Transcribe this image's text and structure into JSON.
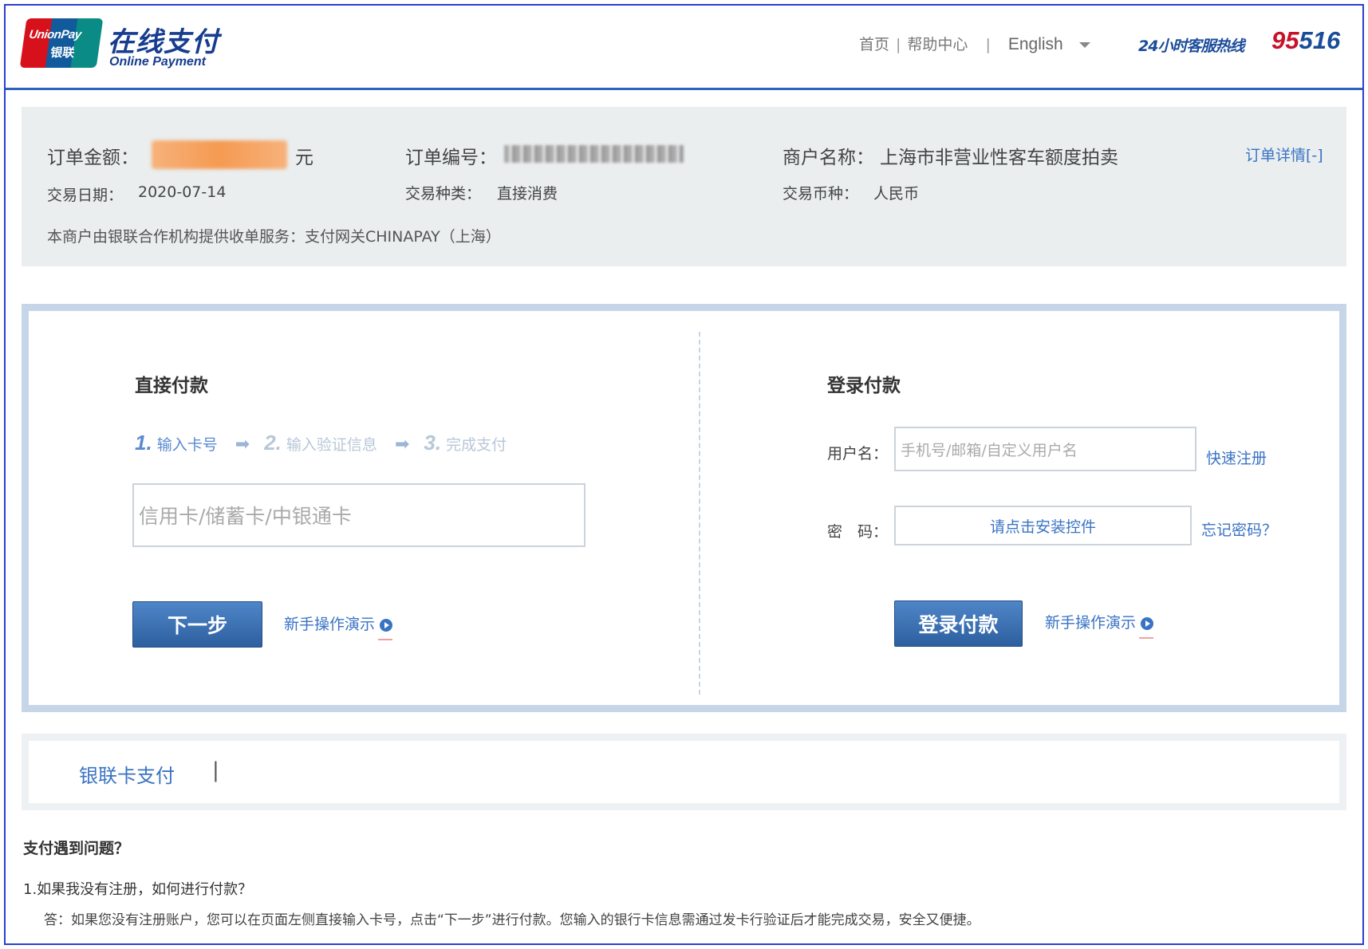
{
  "header": {
    "logo_top": "UnionPay",
    "logo_bottom": "银联",
    "brand_cn": "在线支付",
    "brand_en": "Online Payment",
    "nav_home": "首页",
    "nav_sep": "|",
    "nav_help": "帮助中心",
    "nav_language": "English",
    "hotline_label": "24小时客服热线",
    "hotline_number_red": "95",
    "hotline_number_blue": "516"
  },
  "order": {
    "amount_label": "订单金额：",
    "amount_unit": "元",
    "order_no_label": "订单编号：",
    "merchant_label": "商户名称：",
    "merchant_name": "上海市非营业性客车额度拍卖",
    "detail_link": "订单详情[-]",
    "date_label": "交易日期：",
    "date_value": "2020-07-14",
    "type_label": "交易种类：",
    "type_value": "直接消费",
    "currency_label": "交易币种：",
    "currency_value": "人民币",
    "service_note": "本商户由银联合作机构提供收单服务：支付网关CHINAPAY（上海）"
  },
  "direct_pay": {
    "title": "直接付款",
    "steps": [
      {
        "num": "1.",
        "label": "输入卡号"
      },
      {
        "num": "2.",
        "label": "输入验证信息"
      },
      {
        "num": "3.",
        "label": "完成支付"
      }
    ],
    "arrow": "➡",
    "card_placeholder": "信用卡/储蓄卡/中银通卡",
    "next_button": "下一步",
    "demo_link": "新手操作演示"
  },
  "login_pay": {
    "title": "登录付款",
    "username_label": "用户名：",
    "username_placeholder": "手机号/邮箱/自定义用户名",
    "register_link": "快速注册",
    "password_label": "密　码：",
    "password_control": "请点击安装控件",
    "forgot_link": "忘记密码？",
    "login_button": "登录付款",
    "demo_link": "新手操作演示"
  },
  "tabs": {
    "unionpay_card": "银联卡支付",
    "separator": "|"
  },
  "faq": {
    "title": "支付遇到问题？",
    "question": "1.如果我没有注册，如何进行付款？",
    "answer": "答：如果您没有注册账户，您可以在页面左侧直接输入卡号，点击“下一步”进行付款。您输入的银行卡信息需通过发卡行验证后才能完成交易，安全又便捷。"
  }
}
